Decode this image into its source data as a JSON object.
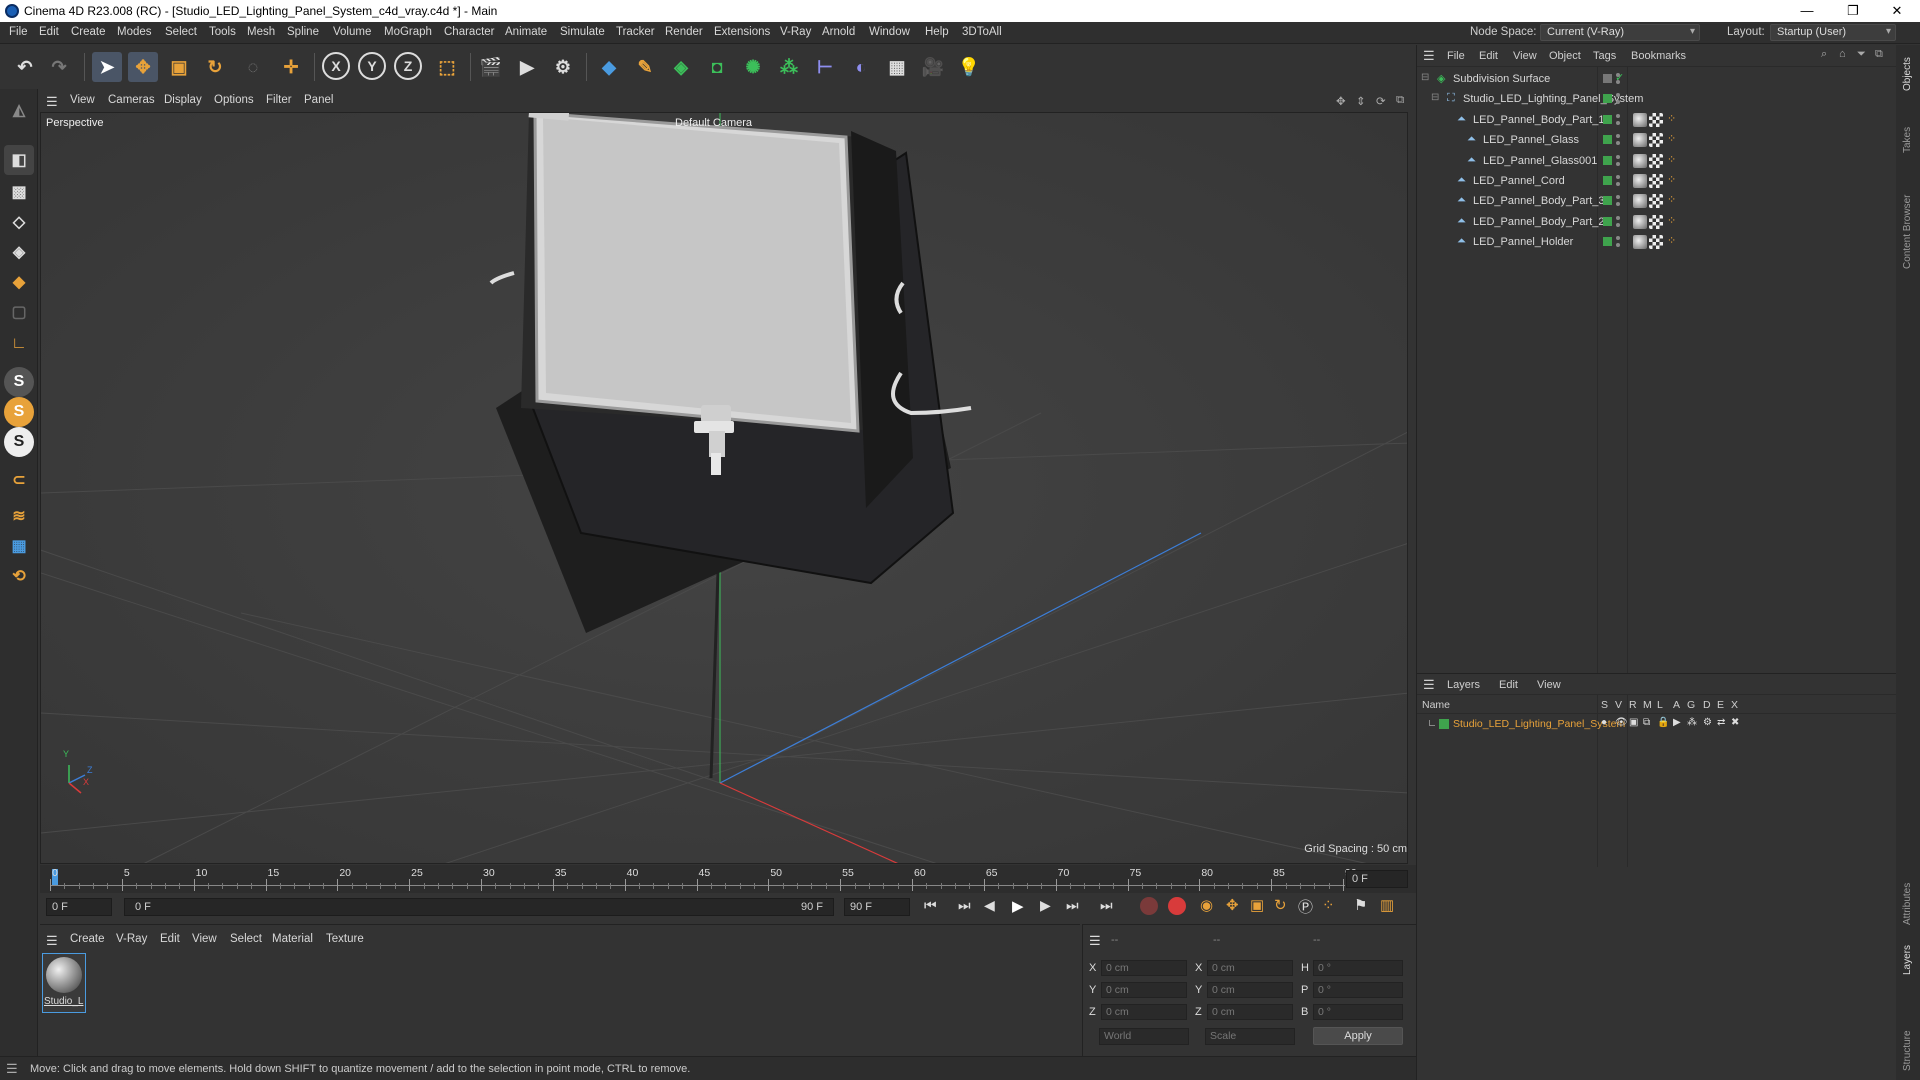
{
  "window": {
    "title": "Cinema 4D R23.008 (RC) - [Studio_LED_Lighting_Panel_System_c4d_vray.c4d *] - Main",
    "controls": [
      "—",
      "❐",
      "✕"
    ]
  },
  "menubar": {
    "items": [
      "File",
      "Edit",
      "Create",
      "Modes",
      "Select",
      "Tools",
      "Mesh",
      "Spline",
      "Volume",
      "MoGraph",
      "Character",
      "Animate",
      "Simulate",
      "Tracker",
      "Render",
      "Extensions",
      "V-Ray",
      "Arnold",
      "Window",
      "Help",
      "3DToAll"
    ],
    "node_space_label": "Node Space:",
    "node_space_value": "Current (V-Ray)",
    "layout_label": "Layout:",
    "layout_value": "Startup (User)"
  },
  "viewport": {
    "menu": [
      "View",
      "Cameras",
      "Display",
      "Options",
      "Filter",
      "Panel"
    ],
    "view_name": "Perspective",
    "camera_label": "Default Camera",
    "grid_spacing": "Grid Spacing : 50 cm",
    "axis_labels": {
      "y": "Y",
      "z": "Z",
      "x": "X"
    }
  },
  "timeline": {
    "ticks": [
      "0",
      "5",
      "10",
      "15",
      "20",
      "25",
      "30",
      "35",
      "40",
      "45",
      "50",
      "55",
      "60",
      "65",
      "70",
      "75",
      "80",
      "85",
      "90"
    ],
    "current_frame": "0 F",
    "start_field": "0 F",
    "range_start": "0 F",
    "range_end": "90 F",
    "end_field": "90 F"
  },
  "materials": {
    "menu": [
      "Create",
      "V-Ray",
      "Edit",
      "View",
      "Select",
      "Material",
      "Texture"
    ],
    "items": [
      {
        "label": "Studio_L"
      }
    ]
  },
  "coords": {
    "header": [
      "--",
      "--",
      "--"
    ],
    "rows": [
      {
        "a": "X",
        "av": "0 cm",
        "b": "X",
        "bv": "0 cm",
        "c": "H",
        "cv": "0 °"
      },
      {
        "a": "Y",
        "av": "0 cm",
        "b": "Y",
        "bv": "0 cm",
        "c": "P",
        "cv": "0 °"
      },
      {
        "a": "Z",
        "av": "0 cm",
        "b": "Z",
        "bv": "0 cm",
        "c": "B",
        "cv": "0 °"
      }
    ],
    "world": "World",
    "scale": "Scale",
    "apply": "Apply"
  },
  "status": {
    "text": "Move: Click and drag to move elements. Hold down SHIFT to quantize movement / add to the selection in point mode, CTRL to remove."
  },
  "objects": {
    "menu": [
      "File",
      "Edit",
      "View",
      "Object",
      "Tags",
      "Bookmarks"
    ],
    "tree": [
      {
        "name": "Subdivision Surface",
        "indent": 0
      },
      {
        "name": "Studio_LED_Lighting_Panel_System",
        "indent": 1
      },
      {
        "name": "LED_Pannel_Body_Part_1",
        "indent": 2
      },
      {
        "name": "LED_Pannel_Glass",
        "indent": 3
      },
      {
        "name": "LED_Pannel_Glass001",
        "indent": 3
      },
      {
        "name": "LED_Pannel_Cord",
        "indent": 2
      },
      {
        "name": "LED_Pannel_Body_Part_3",
        "indent": 2
      },
      {
        "name": "LED_Pannel_Body_Part_2",
        "indent": 2
      },
      {
        "name": "LED_Pannel_Holder",
        "indent": 2
      }
    ]
  },
  "layers": {
    "menu": [
      "Layers",
      "Edit",
      "View"
    ],
    "columns": [
      "Name",
      "S",
      "V",
      "R",
      "M",
      "L",
      "A",
      "G",
      "D",
      "E",
      "X"
    ],
    "items": [
      {
        "name": "Studio_LED_Lighting_Panel_System",
        "color": "#3fa34d"
      }
    ]
  },
  "side_tabs": [
    "Objects",
    "Takes",
    "Content Browser",
    "Attributes",
    "Layers",
    "Structure"
  ],
  "colors": {
    "accent_orange": "#e8a23a",
    "accent_blue": "#4a9be0",
    "layer_green": "#3fa34d",
    "axis_red": "#d83b3b",
    "axis_green": "#3cbf5a",
    "axis_blue": "#3c7ed8"
  }
}
